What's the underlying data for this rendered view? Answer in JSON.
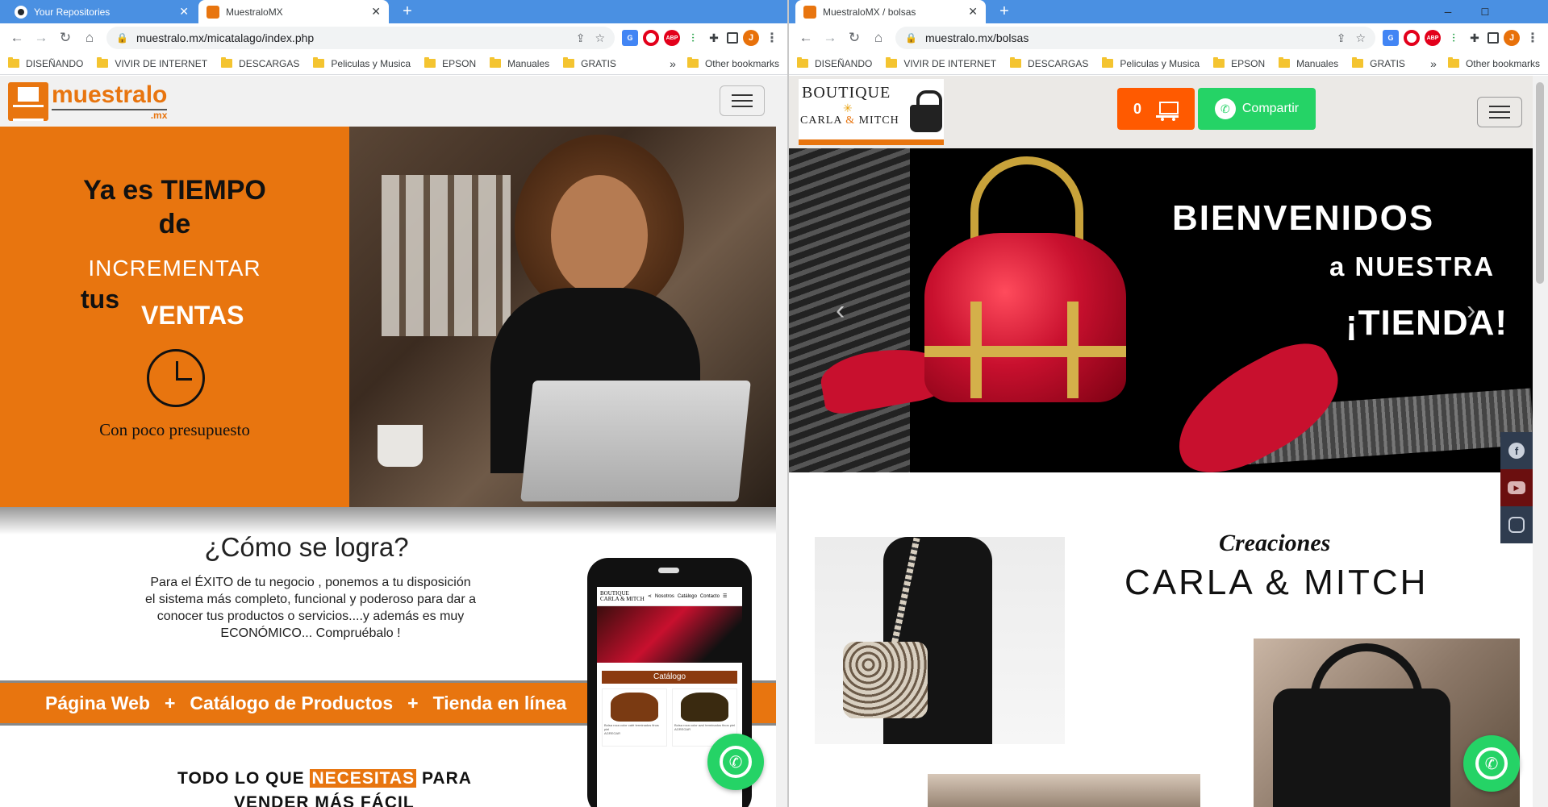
{
  "left_window": {
    "tabs": [
      {
        "title": "Your Repositories",
        "favicon": "github-icon",
        "active": false
      },
      {
        "title": "MuestraloMX",
        "favicon": "muestralo-favicon",
        "active": true
      }
    ],
    "url": "muestralo.mx/micatalago/index.php",
    "bookmarks": [
      "DISEÑANDO",
      "VIVIR DE INTERNET",
      "DESCARGAS",
      "Peliculas y Musica",
      "EPSON",
      "Manuales",
      "GRATIS"
    ],
    "other_bookmarks": "Other bookmarks",
    "page": {
      "logo": {
        "text": "muestralo",
        "sub": ".mx"
      },
      "hero": {
        "line1": "Ya es TIEMPO",
        "line2": "de",
        "line3": "INCREMENTAR",
        "line4": "tus",
        "line5": "VENTAS",
        "line6": "Con poco presupuesto"
      },
      "como": {
        "title": "¿Cómo se logra?",
        "body_1": "Para el ÉXITO de tu negocio , ponemos a tu disposición",
        "body_2": "el sistema más completo, funcional y poderoso para dar a",
        "body_3": "conocer tus productos o servicios....y además es muy",
        "body_4": "ECONÓMICO...   Compruébalo !"
      },
      "band": [
        "Página Web",
        "+",
        "Catálogo de Productos",
        "+",
        "Tienda en línea"
      ],
      "todo": {
        "before": "TODO LO QUE",
        "highlight": "NECESITAS",
        "after": "PARA",
        "line2": "VENDER MÁS FÁCIL"
      },
      "phone": {
        "logo_top": "BOUTIQUE",
        "logo_bottom": "CARLA & MITCH",
        "nav": [
          "Nosotros",
          "Catálogo",
          "Contacto"
        ],
        "catalog_label": "Catálogo",
        "items": [
          {
            "desc": "Bolsa roca color café terminados finos piel",
            "cta": "AGREGAR"
          },
          {
            "desc": "Bolsa roca color azul terminados finos piel",
            "cta": "AGREGAR"
          }
        ]
      }
    }
  },
  "right_window": {
    "tabs": [
      {
        "title": "MuestraloMX / bolsas",
        "favicon": "muestralo-favicon",
        "active": true
      }
    ],
    "url": "muestralo.mx/bolsas",
    "profile_initial": "J",
    "bookmarks": [
      "DISEÑANDO",
      "VIVIR DE INTERNET",
      "DESCARGAS",
      "Peliculas y Musica",
      "EPSON",
      "Manuales",
      "GRATIS"
    ],
    "other_bookmarks": "Other bookmarks",
    "page": {
      "logo": {
        "top": "BOUTIQUE",
        "bottom_left": "CARLA",
        "bottom_amp": "&",
        "bottom_right": "MITCH"
      },
      "cart_count": "0",
      "share_label": "Compartir",
      "hero": {
        "line1": "BIENVENIDOS",
        "line2": "a NUESTRA",
        "line3": "¡TIENDA!"
      },
      "creaciones": "Creaciones",
      "brand": "CARLA & MITCH"
    }
  },
  "colors": {
    "orange": "#e8750f",
    "whatsapp_green": "#25d366",
    "cart_orange": "#ff5a00",
    "chrome_blue": "#4a90e2"
  }
}
